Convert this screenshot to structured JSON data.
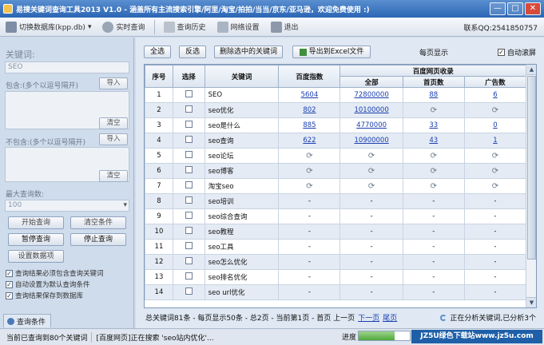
{
  "window": {
    "title": "易搜关键词查询工具2013 V1.0 - 涵盖所有主流搜索引擎/阿里/淘宝/拍拍/当当/京东/亚马逊，欢迎免费使用 :)",
    "minimize": "—",
    "maximize": "□",
    "close": "✕"
  },
  "toolbar": {
    "switch_db": "切换数据库(kpp.db)",
    "realtime": "实时查询",
    "history": "查询历史",
    "network": "网络设置",
    "exit": "退出",
    "qq": "联系QQ:2541850757"
  },
  "left": {
    "keyword_label": "关键词:",
    "keyword_value": "SEO",
    "include_label": "包含:(多个以逗号隔开)",
    "exclude_label": "不包含:(多个以逗号隔开)",
    "import1": "导入",
    "clear1": "清空",
    "import2": "导入",
    "clear2": "清空",
    "maxq_label": "最大查询数:",
    "maxq_value": "100",
    "start": "开始查询",
    "clear_cond": "清空条件",
    "pause": "暂停查询",
    "stop": "停止查询",
    "set_items": "设置数据项",
    "opt1": "查询结果必须包含查询关键词",
    "opt2": "自动设置为默认查询条件",
    "opt3": "查询结果保存到数据库",
    "tab": "查询条件"
  },
  "actions": {
    "select_all": "全选",
    "invert": "反选",
    "delete_selected": "删除选中的关键词",
    "export": "导出到Excel文件",
    "per_page": "每页显示",
    "autoscroll": "自动滚屏"
  },
  "table": {
    "headers": {
      "no": "序号",
      "select": "选择",
      "keyword": "关键词",
      "baidu_index": "百度指数",
      "baidu_group": "百度网页收录",
      "all": "全部",
      "home": "首页数",
      "ads": "广告数"
    },
    "rows": [
      {
        "no": "1",
        "kw": "SEO",
        "idx": "5604",
        "all": "72800000",
        "home": "88",
        "ads": "6"
      },
      {
        "no": "2",
        "kw": "seo优化",
        "idx": "802",
        "all": "10100000",
        "home": "⟳",
        "ads": "⟳"
      },
      {
        "no": "3",
        "kw": "seo是什么",
        "idx": "885",
        "all": "4770000",
        "home": "33",
        "ads": "0"
      },
      {
        "no": "4",
        "kw": "seo查询",
        "idx": "622",
        "all": "10900000",
        "home": "43",
        "ads": "1"
      },
      {
        "no": "5",
        "kw": "seo论坛",
        "idx": "⟳",
        "all": "⟳",
        "home": "⟳",
        "ads": "⟳"
      },
      {
        "no": "6",
        "kw": "seo博客",
        "idx": "⟳",
        "all": "⟳",
        "home": "⟳",
        "ads": "⟳"
      },
      {
        "no": "7",
        "kw": "淘宝seo",
        "idx": "⟳",
        "all": "⟳",
        "home": "⟳",
        "ads": "⟳"
      },
      {
        "no": "8",
        "kw": "seo培训",
        "idx": "-",
        "all": "-",
        "home": "-",
        "ads": "-"
      },
      {
        "no": "9",
        "kw": "seo综合查询",
        "idx": "-",
        "all": "-",
        "home": "-",
        "ads": "-"
      },
      {
        "no": "10",
        "kw": "seo教程",
        "idx": "-",
        "all": "-",
        "home": "-",
        "ads": "-"
      },
      {
        "no": "11",
        "kw": "seo工具",
        "idx": "-",
        "all": "-",
        "home": "-",
        "ads": "-"
      },
      {
        "no": "12",
        "kw": "seo怎么优化",
        "idx": "-",
        "all": "-",
        "home": "-",
        "ads": "-"
      },
      {
        "no": "13",
        "kw": "seo排名优化",
        "idx": "-",
        "all": "-",
        "home": "-",
        "ads": "-"
      },
      {
        "no": "14",
        "kw": "seo url优化",
        "idx": "-",
        "all": "-",
        "home": "-",
        "ads": "-"
      }
    ]
  },
  "pager": {
    "summary": "总关键词81条 - 每页显示50条 - 总2页 - 当前第1页 - 首页 上一页",
    "next": "下一页",
    "last": "尾页",
    "analyzing": "正在分析关键词,已分析3个"
  },
  "status": {
    "current": "当前已查询到80个关键词",
    "searching": "[百度网页]正在搜索 'seo站内优化'...",
    "progress_label": "进度",
    "progress": 0.7,
    "watermark": "JZ5U绿色下载站www.jz5u.com"
  }
}
